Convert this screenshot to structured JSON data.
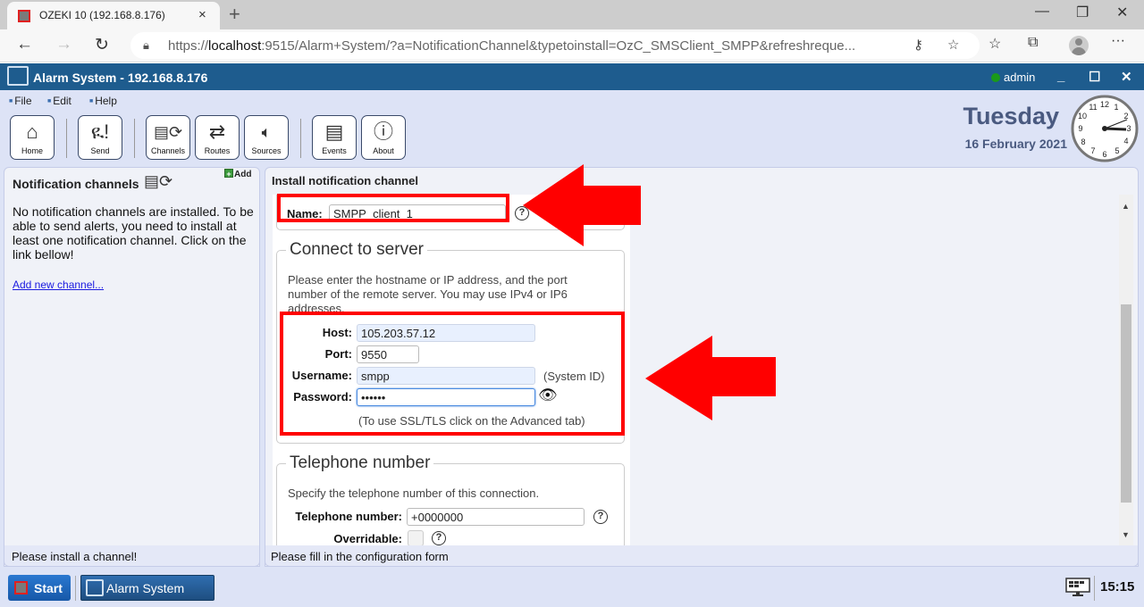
{
  "browser": {
    "tab_title": "OZEKI 10 (192.168.8.176)",
    "url_prefix": "https://",
    "url_host": "localhost",
    "url_rest": ":9515/Alarm+System/?a=NotificationChannel&typetoinstall=OzC_SMSClient_SMPP&refreshreque...",
    "close_tab_glyph": "×",
    "new_tab_glyph": "+"
  },
  "app": {
    "title": "Alarm System - 192.168.8.176",
    "user": "admin",
    "user_status_color": "#1a9a1a",
    "menu": [
      "File",
      "Edit",
      "Help"
    ],
    "toolbar": [
      {
        "label": "Home",
        "icon": "home-icon"
      },
      {
        "label": "Send",
        "icon": "send-alert-icon"
      },
      {
        "label": "Channels",
        "icon": "channels-icon"
      },
      {
        "label": "Routes",
        "icon": "routes-icon"
      },
      {
        "label": "Sources",
        "icon": "sources-icon"
      },
      {
        "label": "Events",
        "icon": "events-icon"
      },
      {
        "label": "About",
        "icon": "about-icon"
      }
    ],
    "day": "Tuesday",
    "date": "16 February 2021",
    "clock_time": "15:15"
  },
  "left_panel": {
    "title": "Notification channels",
    "add_label": "Add",
    "message": "No notification channels are installed. To be able to send alerts, you need to install at least one notification channel. Click on the link bellow!",
    "link": "Add new channel...",
    "status": "Please install a channel!"
  },
  "right_panel": {
    "title": "Install notification channel",
    "status": "Please fill in the configuration form",
    "name_label": "Name:",
    "name_value": "SMPP_client_1",
    "connect": {
      "legend": "Connect to server",
      "description": "Please enter the hostname or IP address, and the port number of the remote server. You may use IPv4 or IP6 addresses.",
      "host_label": "Host:",
      "host_value": "105.203.57.12",
      "port_label": "Port:",
      "port_value": "9550",
      "username_label": "Username:",
      "username_value": "smpp",
      "username_hint": "(System ID)",
      "password_label": "Password:",
      "password_value": "••••••",
      "ssl_hint": "(To use SSL/TLS click on the Advanced tab)"
    },
    "telephone": {
      "legend": "Telephone number",
      "description": "Specify the telephone number of this connection.",
      "number_label": "Telephone number:",
      "number_value": "+0000000",
      "overridable_label": "Overridable:",
      "overridable_checked": false
    },
    "help_glyph": "?"
  },
  "annotation_color": "#ff0000",
  "taskbar": {
    "start_label": "Start",
    "app_label": "Alarm System",
    "time": "15:15"
  }
}
